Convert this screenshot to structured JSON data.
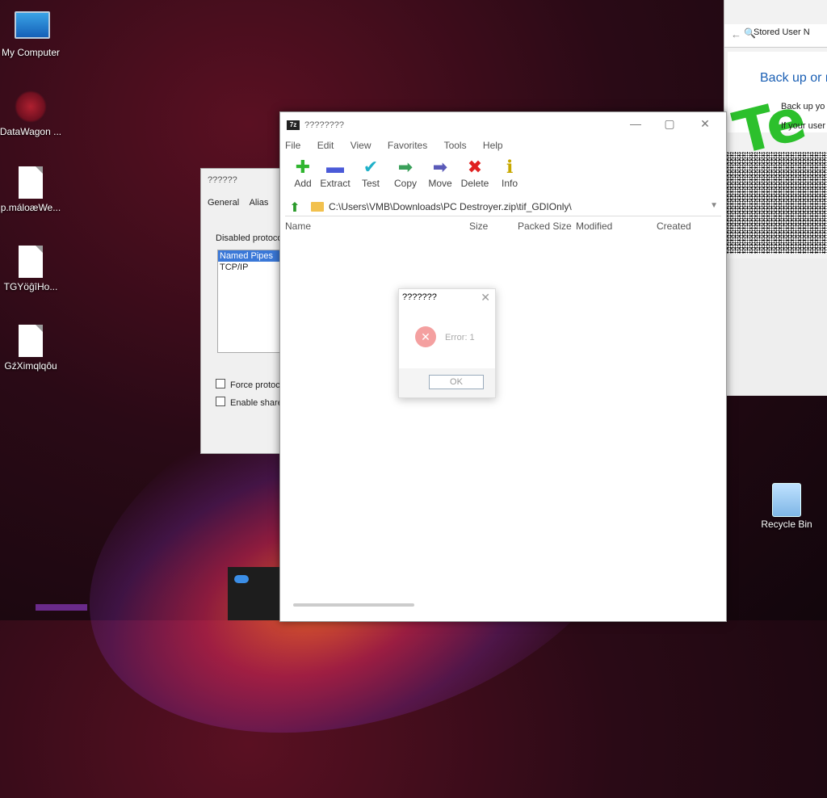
{
  "desktop": {
    "icons": [
      {
        "label": "My Computer",
        "icon": "computer-icon"
      },
      {
        "label": "DataWagon ...",
        "icon": "datawagon-icon"
      },
      {
        "label": "p.máloæWe...",
        "icon": "file-icon"
      },
      {
        "label": "TGYöĝîHo...",
        "icon": "file-icon"
      },
      {
        "label": "GźXimqlqôu",
        "icon": "file-icon"
      },
      {
        "label": "Recycle Bin",
        "icon": "recycle-bin-icon"
      }
    ]
  },
  "browser": {
    "tab_title": "Stored User N",
    "overlay_text": "Te",
    "heading": "Back up or r",
    "sub1": "Back up yo",
    "sub2": "If your user"
  },
  "props_dialog": {
    "title": "??????",
    "tabs": [
      "General",
      "Alias"
    ],
    "disabled_label": "Disabled protoco",
    "protocols": [
      "Named Pipes",
      "TCP/IP"
    ],
    "check1": "Force protoc",
    "check2": "Enable share"
  },
  "zip_window": {
    "title": "????????",
    "app_icon_text": "7z",
    "menu": [
      "File",
      "Edit",
      "View",
      "Favorites",
      "Tools",
      "Help"
    ],
    "toolbar": [
      {
        "label": "Add",
        "icon": "plus-icon",
        "color": "#2fb52f"
      },
      {
        "label": "Extract",
        "icon": "extract-icon",
        "color": "#4a5ad8"
      },
      {
        "label": "Test",
        "icon": "test-icon",
        "color": "#1fb0c8"
      },
      {
        "label": "Copy",
        "icon": "copy-icon",
        "color": "#3aa05a"
      },
      {
        "label": "Move",
        "icon": "move-icon",
        "color": "#5a5ab8"
      },
      {
        "label": "Delete",
        "icon": "delete-icon",
        "color": "#e02020"
      },
      {
        "label": "Info",
        "icon": "info-icon",
        "color": "#c8a800"
      }
    ],
    "path": "C:\\Users\\VMB\\Downloads\\PC Destroyer.zip\\tif_GDIOnly\\",
    "columns": [
      "Name",
      "Size",
      "Packed Size",
      "Modified",
      "Created"
    ]
  },
  "error_dialog": {
    "title": "???????",
    "message": "Error: 1",
    "ok_label": "OK"
  },
  "colors": {
    "wallpaper": "#2a0a16",
    "accent_selection": "#3a78d8",
    "error_icon": "#f4a0a0",
    "overlay_green": "#2cc02c"
  }
}
